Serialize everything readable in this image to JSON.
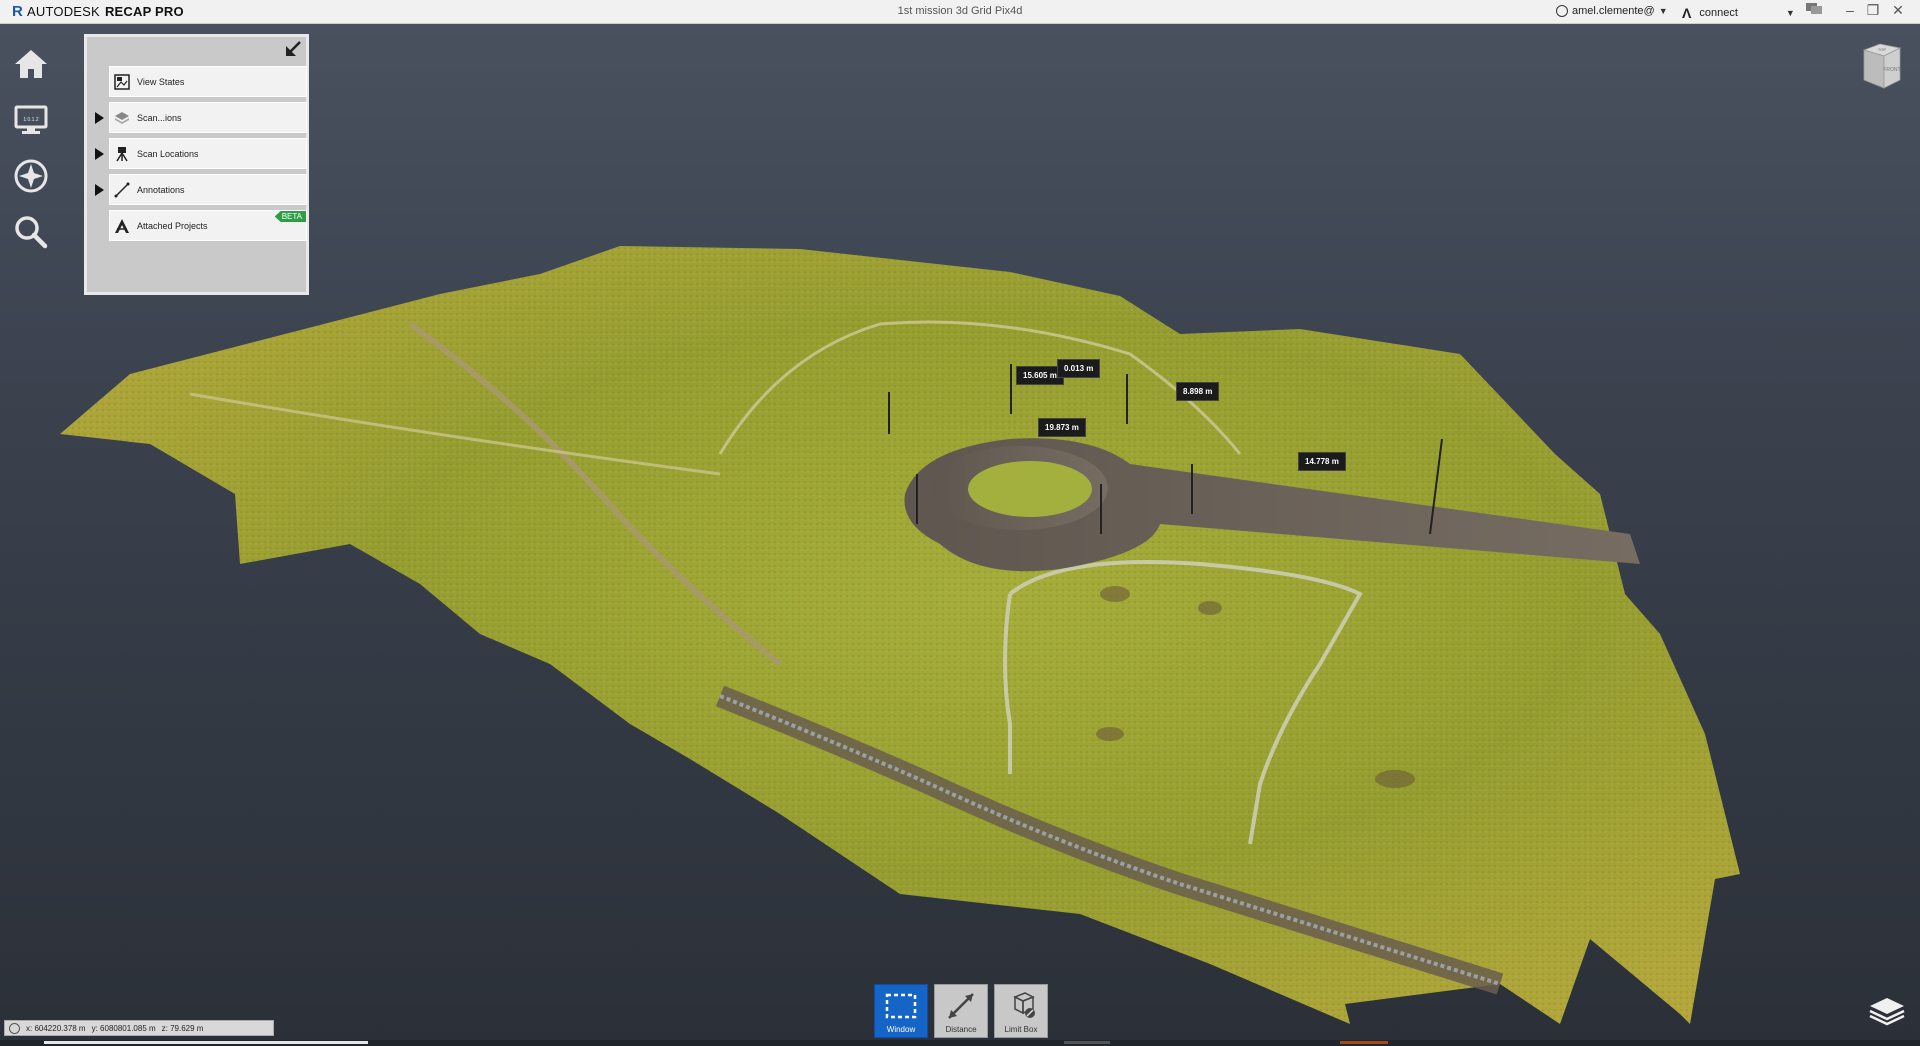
{
  "app": {
    "brand": "AUTODESK",
    "product": "RECAP PRO",
    "window_title": "1st mission 3d Grid Pix4d"
  },
  "header": {
    "user": "amel.clemente@",
    "connect": "connect"
  },
  "left_nav": {
    "items": [
      {
        "name": "home"
      },
      {
        "name": "display"
      },
      {
        "name": "navigation"
      },
      {
        "name": "search"
      }
    ],
    "display_icon_text": "1:0.1.2"
  },
  "panel": {
    "rows": [
      {
        "label": "View States",
        "icon": "view-states-icon",
        "expandable": false
      },
      {
        "label": "Scan...ions",
        "icon": "scan-regions-icon",
        "expandable": true
      },
      {
        "label": "Scan Locations",
        "icon": "scan-locations-icon",
        "expandable": true
      },
      {
        "label": "Annotations",
        "icon": "annotations-icon",
        "expandable": true
      },
      {
        "label": "Attached Projects",
        "icon": "attached-projects-icon",
        "expandable": false,
        "badge": "BETA"
      }
    ]
  },
  "viewcube": {
    "face_top": "TOP",
    "face_front": "FRONT"
  },
  "measurements": [
    {
      "label": "15.605 m"
    },
    {
      "label": "0.013 m"
    },
    {
      "label": "8.898 m"
    },
    {
      "label": "19.873 m"
    },
    {
      "label": "14.778 m"
    }
  ],
  "bottom_tools": [
    {
      "label": "Window",
      "active": true
    },
    {
      "label": "Distance",
      "active": false
    },
    {
      "label": "Limit Box",
      "active": false
    }
  ],
  "status": {
    "x": "x: 604220.378 m",
    "y": "y: 6080801.085 m",
    "z": "z: 79.629 m"
  },
  "colors": {
    "accent": "#1565c6",
    "beta": "#2e9e44",
    "grass": "#9aa436",
    "road": "#6b6258"
  }
}
